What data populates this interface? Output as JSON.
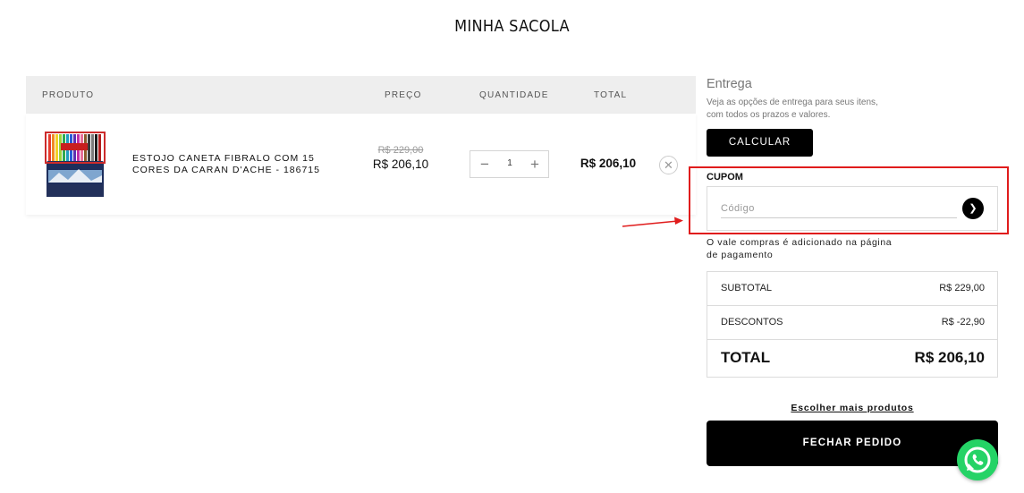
{
  "page": {
    "title": "MINHA SACOLA"
  },
  "cart": {
    "headers": {
      "product": "PRODUTO",
      "price": "PREÇO",
      "quantity": "QUANTIDADE",
      "total": "TOTAL"
    },
    "items": [
      {
        "name": "ESTOJO CANETA FIBRALO COM 15 CORES DA CARAN D'ACHE - 186715",
        "old_price": "R$ 229,00",
        "price": "R$ 206,10",
        "quantity": "1",
        "total": "R$ 206,10"
      }
    ],
    "remove_icon": "close-icon",
    "qty_minus_icon": "minus-icon",
    "qty_plus_icon": "plus-icon"
  },
  "delivery": {
    "title": "Entrega",
    "description": "Veja as opções de entrega para seus itens, com todos os prazos e valores.",
    "button": "CALCULAR"
  },
  "coupon": {
    "label": "CUPOM",
    "placeholder": "Código",
    "submit_icon": "chevron-right-icon",
    "highlight_color": "#e01c1c",
    "note": "O vale compras é adicionado na página de pagamento"
  },
  "summary": {
    "subtotal_label": "SUBTOTAL",
    "subtotal_value": "R$ 229,00",
    "discount_label": "DESCONTOS",
    "discount_value": "R$ -22,90",
    "total_label": "TOTAL",
    "total_value": "R$ 206,10"
  },
  "actions": {
    "more_products": "Escolher mais produtos",
    "checkout": "FECHAR PEDIDO"
  },
  "colors": {
    "accent": "#000000",
    "whatsapp": "#25d366",
    "header_bg": "#eeeeee"
  },
  "widgets": {
    "whatsapp_icon": "whatsapp-icon"
  }
}
